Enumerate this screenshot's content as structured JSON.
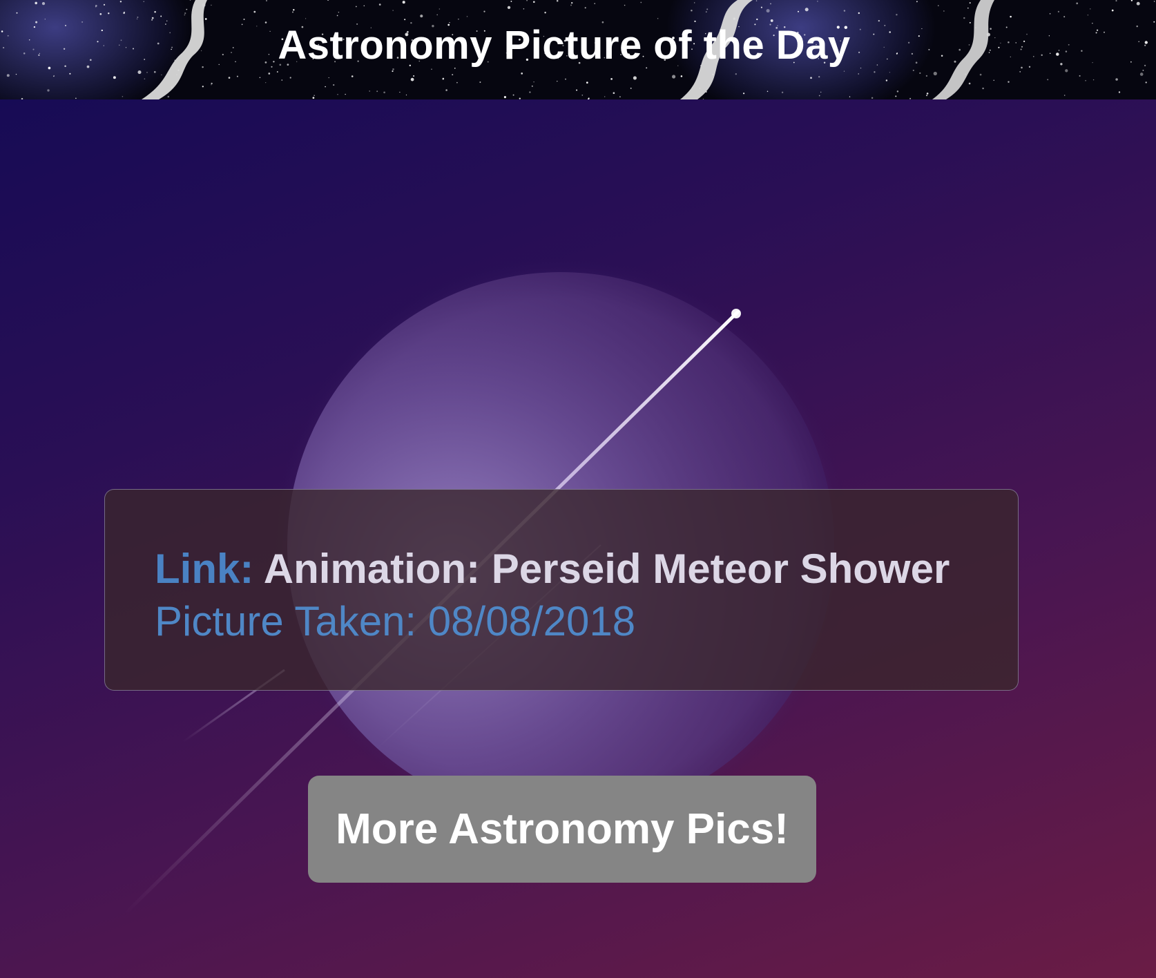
{
  "header": {
    "title": "Astronomy Picture of the Day"
  },
  "picture": {
    "description_icon": "meteor-planet-image"
  },
  "info_card": {
    "link_label": "Link:",
    "title": "Animation: Perseid Meteor Shower",
    "date_label": "Picture Taken:",
    "date_value": "08/08/2018"
  },
  "more_button": {
    "label": "More Astronomy Pics!"
  },
  "colors": {
    "link_label": "#4a82c3",
    "date_text": "#4f87c6",
    "button_bg": "#858585",
    "card_border": "#aaaac8"
  }
}
